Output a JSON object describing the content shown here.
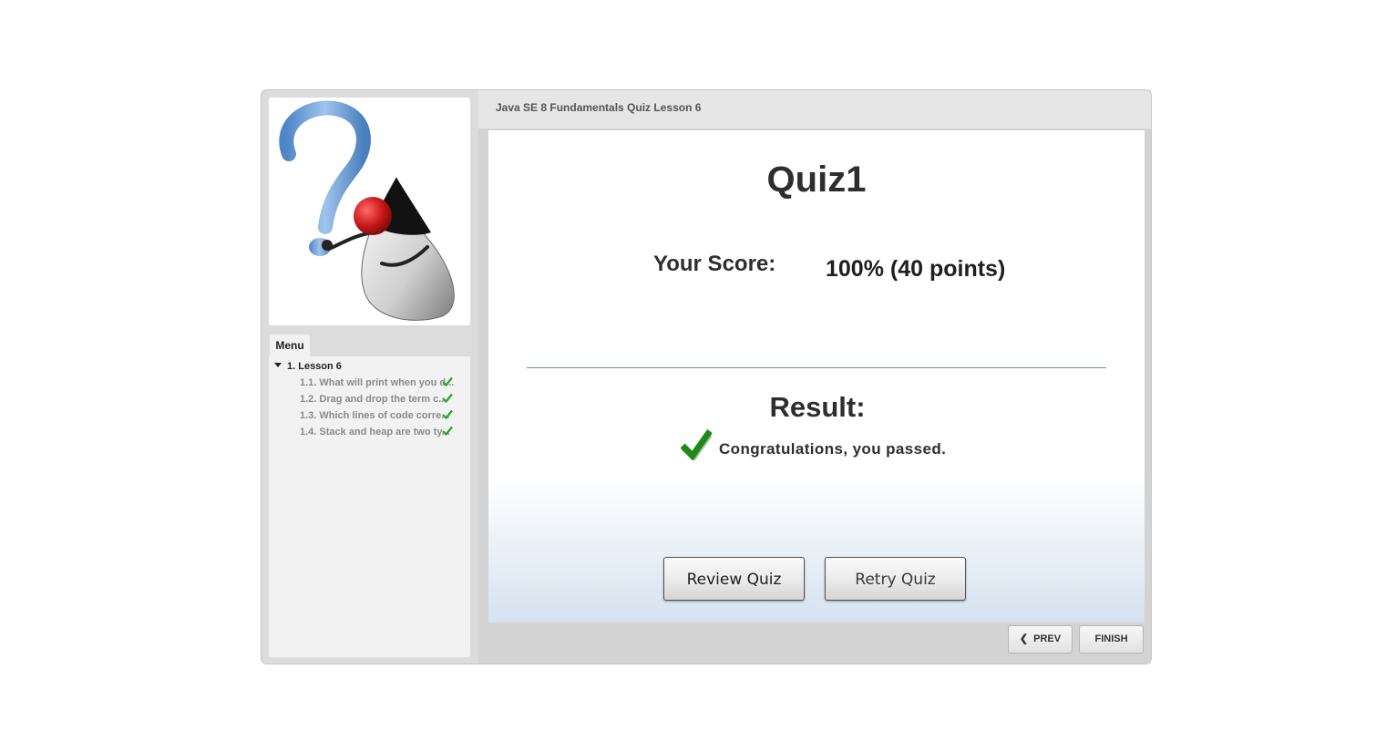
{
  "header": {
    "title": "Java SE 8 Fundamentals Quiz Lesson 6"
  },
  "sidebar": {
    "logo_icon": "duke-question-mark-icon",
    "menu_tab_label": "Menu",
    "lesson_label": "1. Lesson 6",
    "items": [
      {
        "label": "1.1. What will print when you d...",
        "status": "complete"
      },
      {
        "label": "1.2. Drag and drop the term c...",
        "status": "complete"
      },
      {
        "label": "1.3. Which lines of code corre...",
        "status": "complete"
      },
      {
        "label": "1.4. Stack and heap are two ty...",
        "status": "complete"
      }
    ]
  },
  "slide": {
    "quiz_title": "Quiz1",
    "score_label": "Your Score:",
    "score_value": "100% (40 points)",
    "result_label": "Result:",
    "result_message": "Congratulations, you passed.",
    "review_button": "Review Quiz",
    "retry_button": "Retry Quiz"
  },
  "navigation": {
    "prev_label": "PREV",
    "finish_label": "FINISH"
  },
  "colors": {
    "check_green": "#1f8a1a",
    "menu_check_green": "#2aa32a",
    "divider": "#6d8aa0"
  }
}
